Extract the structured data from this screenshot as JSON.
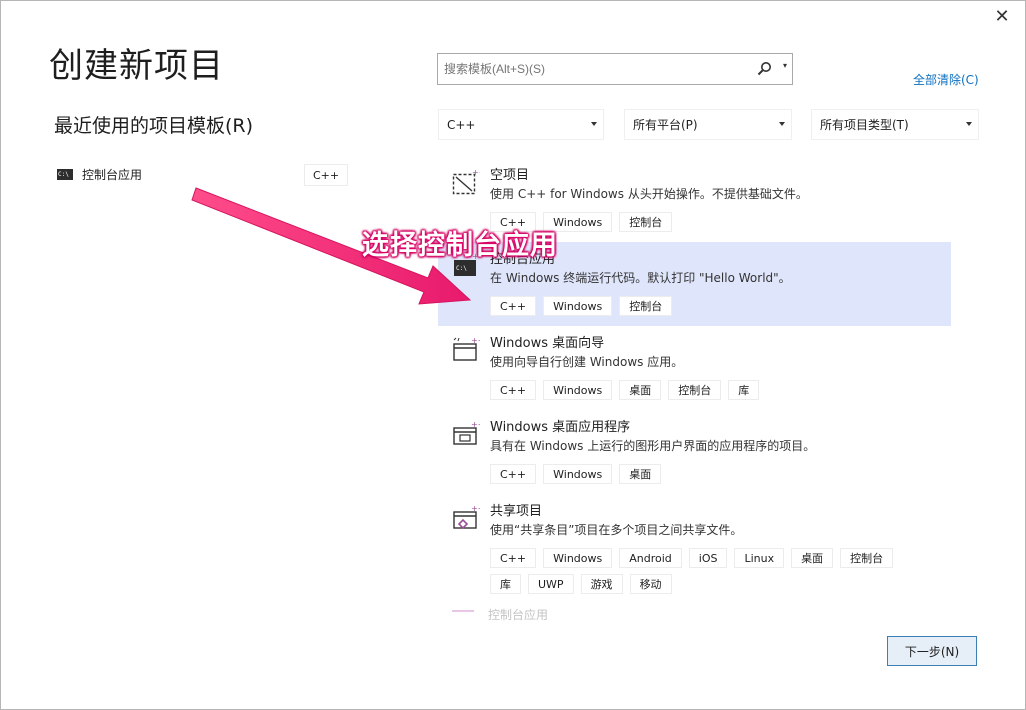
{
  "window": {
    "close_glyph": "✕"
  },
  "header": {
    "title": "创建新项目",
    "recent_title": "最近使用的项目模板(R)"
  },
  "recent": [
    {
      "icon_text": "C:\\",
      "name": "控制台应用",
      "lang": "C++"
    }
  ],
  "search": {
    "placeholder": "搜索模板(Alt+S)(S)",
    "value": ""
  },
  "clear_all": "全部清除(C)",
  "filters": {
    "language": "C++",
    "platform": "所有平台(P)",
    "project_type": "所有项目类型(T)"
  },
  "templates": [
    {
      "name": "空项目",
      "desc": "使用 C++ for Windows 从头开始操作。不提供基础文件。",
      "tags": [
        "C++",
        "Windows",
        "控制台"
      ],
      "selected": false
    },
    {
      "name": "控制台应用",
      "desc": "在 Windows 终端运行代码。默认打印 \"Hello World\"。",
      "tags": [
        "C++",
        "Windows",
        "控制台"
      ],
      "selected": true
    },
    {
      "name": "Windows 桌面向导",
      "desc": "使用向导自行创建 Windows 应用。",
      "tags": [
        "C++",
        "Windows",
        "桌面",
        "控制台",
        "库"
      ],
      "selected": false
    },
    {
      "name": "Windows 桌面应用程序",
      "desc": "具有在 Windows 上运行的图形用户界面的应用程序的项目。",
      "tags": [
        "C++",
        "Windows",
        "桌面"
      ],
      "selected": false
    },
    {
      "name": "共享项目",
      "desc": "使用“共享条目”项目在多个项目之间共享文件。",
      "tags": [
        "C++",
        "Windows",
        "Android",
        "iOS",
        "Linux",
        "桌面",
        "控制台",
        "库",
        "UWP",
        "游戏",
        "移动"
      ],
      "selected": false
    }
  ],
  "faded_item": "控制台应用",
  "next_button": "下一步(N)",
  "annotation": {
    "text": "选择控制台应用",
    "color": "#e8196c"
  },
  "colors": {
    "selected_bg": "#dfe5fb",
    "link": "#0e70c0",
    "accent": "#3c7fb1"
  }
}
